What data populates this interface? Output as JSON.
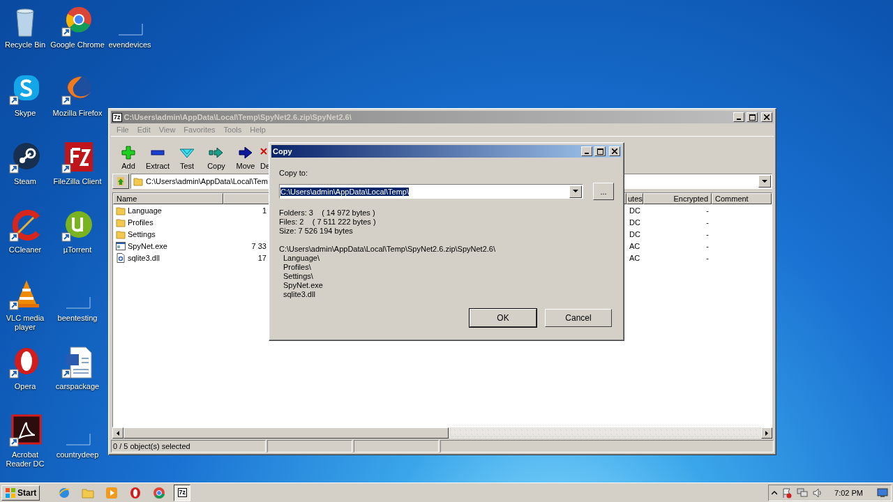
{
  "desktop_icons": [
    {
      "label": "Recycle Bin"
    },
    {
      "label": "Google Chrome"
    },
    {
      "label": "evendevices"
    },
    {
      "label": "Skype"
    },
    {
      "label": "Mozilla Firefox"
    },
    {
      "label": "Steam"
    },
    {
      "label": "FileZilla Client"
    },
    {
      "label": "CCleaner"
    },
    {
      "label": "µTorrent"
    },
    {
      "label": "VLC media player"
    },
    {
      "label": "beentesting"
    },
    {
      "label": "Opera"
    },
    {
      "label": "carspackage"
    },
    {
      "label": "Acrobat Reader DC"
    },
    {
      "label": "countrydeep"
    }
  ],
  "main_window": {
    "icon_text": "7z",
    "title": "C:\\Users\\admin\\AppData\\Local\\Temp\\SpyNet2.6.zip\\SpyNet2.6\\",
    "active": false,
    "menu": [
      "File",
      "Edit",
      "View",
      "Favorites",
      "Tools",
      "Help"
    ],
    "toolbar": [
      {
        "kind": "add",
        "label": "Add"
      },
      {
        "kind": "extract",
        "label": "Extract"
      },
      {
        "kind": "test",
        "label": "Test"
      },
      {
        "kind": "copy",
        "label": "Copy"
      },
      {
        "kind": "move",
        "label": "Move"
      },
      {
        "kind": "delete",
        "label": "De"
      }
    ],
    "address": "C:\\Users\\admin\\AppData\\Local\\Tem",
    "columns": {
      "name": "Name",
      "attributes": "utes",
      "encrypted": "Encrypted",
      "comment": "Comment"
    },
    "rows": [
      {
        "kind": "folder",
        "name": "Language",
        "size": "1",
        "attributes": "DC",
        "encrypted": "-"
      },
      {
        "kind": "folder",
        "name": "Profiles",
        "attributes": "DC",
        "encrypted": "-"
      },
      {
        "kind": "folder",
        "name": "Settings",
        "attributes": "DC",
        "encrypted": "-"
      },
      {
        "kind": "exe",
        "name": "SpyNet.exe",
        "size": "7 33",
        "attributes": "AC",
        "encrypted": "-"
      },
      {
        "kind": "dll",
        "name": "sqlite3.dll",
        "size": "17",
        "attributes": "AC",
        "encrypted": "-"
      }
    ],
    "status": "0 / 5 object(s) selected"
  },
  "dialog": {
    "title": "Copy",
    "active": true,
    "copy_to_label": "Copy to:",
    "destination": {
      "value": "C:\\Users\\admin\\AppData\\Local\\Temp\\",
      "selected": true
    },
    "browse": "...",
    "info": [
      "Folders: 3    ( 14 972 bytes )",
      "Files: 2    ( 7 511 222 bytes )",
      "Size: 7 526 194 bytes"
    ],
    "source_path": "C:\\Users\\admin\\AppData\\Local\\Temp\\SpyNet2.6.zip\\SpyNet2.6\\",
    "items": [
      "Language\\",
      "Profiles\\",
      "Settings\\",
      "SpyNet.exe",
      "sqlite3.dll"
    ],
    "buttons": [
      "OK",
      "Cancel"
    ]
  },
  "taskbar": {
    "start": "Start",
    "apps": [
      {
        "kind": "ie",
        "selected": false
      },
      {
        "kind": "explorer",
        "selected": false
      },
      {
        "kind": "media",
        "selected": false
      },
      {
        "kind": "opera",
        "selected": false
      },
      {
        "kind": "chrome",
        "selected": false
      },
      {
        "kind": "sevenzip",
        "label": "7z",
        "selected": true
      }
    ],
    "clock": "7:02 PM"
  }
}
